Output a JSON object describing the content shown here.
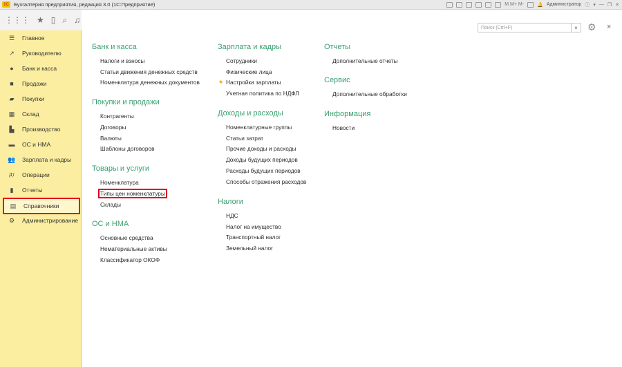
{
  "window": {
    "title": "Бухгалтерия предприятия, редакция 3.0  (1С:Предприятие)",
    "logo_text": "1С",
    "user": "Администратор"
  },
  "sidebar": {
    "items": [
      {
        "label": "Главное",
        "icon": "menu-lines-icon"
      },
      {
        "label": "Руководителю",
        "icon": "trend-icon"
      },
      {
        "label": "Банк и касса",
        "icon": "coin-icon"
      },
      {
        "label": "Продажи",
        "icon": "bag-icon"
      },
      {
        "label": "Покупки",
        "icon": "cart-icon"
      },
      {
        "label": "Склад",
        "icon": "grid-icon"
      },
      {
        "label": "Производство",
        "icon": "factory-icon"
      },
      {
        "label": "ОС и НМА",
        "icon": "truck-icon"
      },
      {
        "label": "Зарплата и кадры",
        "icon": "people-icon"
      },
      {
        "label": "Операции",
        "icon": "operations-icon"
      },
      {
        "label": "Отчеты",
        "icon": "bar-chart-icon"
      },
      {
        "label": "Справочники",
        "icon": "book-icon"
      },
      {
        "label": "Администрирование",
        "icon": "gear-icon"
      }
    ],
    "active_index": 11
  },
  "search": {
    "placeholder": "Поиск (Ctrl+F)"
  },
  "sections": {
    "bank": {
      "title": "Банк и касса",
      "links": [
        "Налоги и взносы",
        "Статьи движения денежных средств",
        "Номенклатура денежных документов"
      ]
    },
    "sales": {
      "title": "Покупки и продажи",
      "links": [
        "Контрагенты",
        "Договоры",
        "Валюты",
        "Шаблоны договоров"
      ]
    },
    "goods": {
      "title": "Товары и услуги",
      "links": [
        "Номенклатура",
        "Типы цен номенклатуры",
        "Склады"
      ]
    },
    "assets": {
      "title": "ОС и НМА",
      "links": [
        "Основные средства",
        "Нематериальные активы",
        "Классификатор ОКОФ"
      ]
    },
    "salary": {
      "title": "Зарплата и кадры",
      "links": [
        "Сотрудники",
        "Физические лица",
        "Настройки зарплаты",
        "Учетная политика по НДФЛ"
      ]
    },
    "income": {
      "title": "Доходы и расходы",
      "links": [
        "Номенклатурные группы",
        "Статьи затрат",
        "Прочие доходы и расходы",
        "Доходы будущих периодов",
        "Расходы будущих периодов",
        "Способы отражения расходов"
      ]
    },
    "taxes": {
      "title": "Налоги",
      "links": [
        "НДС",
        "Налог на имущество",
        "Транспортный налог",
        "Земельный налог"
      ]
    },
    "reports": {
      "title": "Отчеты",
      "links": [
        "Дополнительные отчеты"
      ]
    },
    "service": {
      "title": "Сервис",
      "links": [
        "Дополнительные обработки"
      ]
    },
    "info": {
      "title": "Информация",
      "links": [
        "Новости"
      ]
    }
  },
  "colors": {
    "accent_green": "#3aa06f",
    "sidebar_bg": "#fbeea0",
    "highlight_red": "#e0001b"
  }
}
